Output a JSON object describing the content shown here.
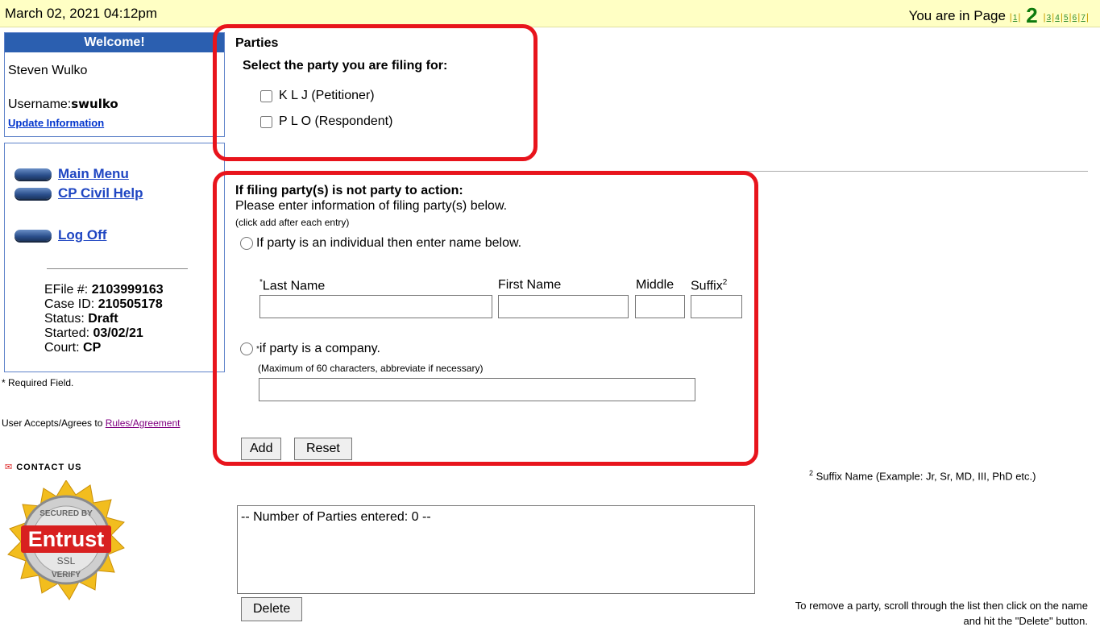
{
  "topbar": {
    "datetime": "March 02, 2021 04:12pm",
    "page_label": "You are in Page",
    "pages": [
      "1",
      "2",
      "3",
      "4",
      "5",
      "6",
      "7"
    ],
    "current_page": "2"
  },
  "welcome": {
    "header": "Welcome!",
    "name": "Steven Wulko",
    "username_label": "Username:",
    "username": "swulko",
    "update_link": "Update Information"
  },
  "nav": {
    "main_menu": "Main Menu",
    "help": "CP Civil Help",
    "logoff": "Log Off"
  },
  "case": {
    "efile_label": "EFile #: ",
    "efile": "2103999163",
    "caseid_label": "Case ID: ",
    "caseid": "210505178",
    "status_label": "Status: ",
    "status": "Draft",
    "started_label": "Started: ",
    "started": "03/02/21",
    "court_label": "Court: ",
    "court": "CP"
  },
  "left_footer": {
    "required": "* Required Field.",
    "accepts": "User Accepts/Agrees to ",
    "rules_link": "Rules/Agreement",
    "contact": "CONTACT US",
    "seal_top": "SECURED BY",
    "seal_brand": "Entrust",
    "seal_ssl": "SSL",
    "seal_bottom": "VERIFY"
  },
  "parties": {
    "title": "Parties",
    "subtitle": "Select the party you are filing for:",
    "options": [
      "K L J (Petitioner)",
      "P L O (Respondent)"
    ]
  },
  "filing": {
    "title": "If filing party(s) is not party to action:",
    "instruction": "Please enter information of filing party(s) below.",
    "hint": "(click add after each entry)",
    "individual_label": "If party is an individual then enter name below.",
    "last_name": "Last Name",
    "first_name": "First Name",
    "middle": "Middle",
    "suffix": "Suffix",
    "company_label": "if party is a company.",
    "company_hint": "(Maximum of 60 characters, abbreviate if necessary)",
    "add": "Add",
    "reset": "Reset",
    "suffix_note": "Suffix Name (Example: Jr, Sr, MD, III, PhD etc.)"
  },
  "list": {
    "count_text": "-- Number of Parties entered: 0 --",
    "delete": "Delete",
    "remove_line1": "To remove a party, scroll through the list then click on the name",
    "remove_line2": "and hit the \"Delete\" button."
  }
}
